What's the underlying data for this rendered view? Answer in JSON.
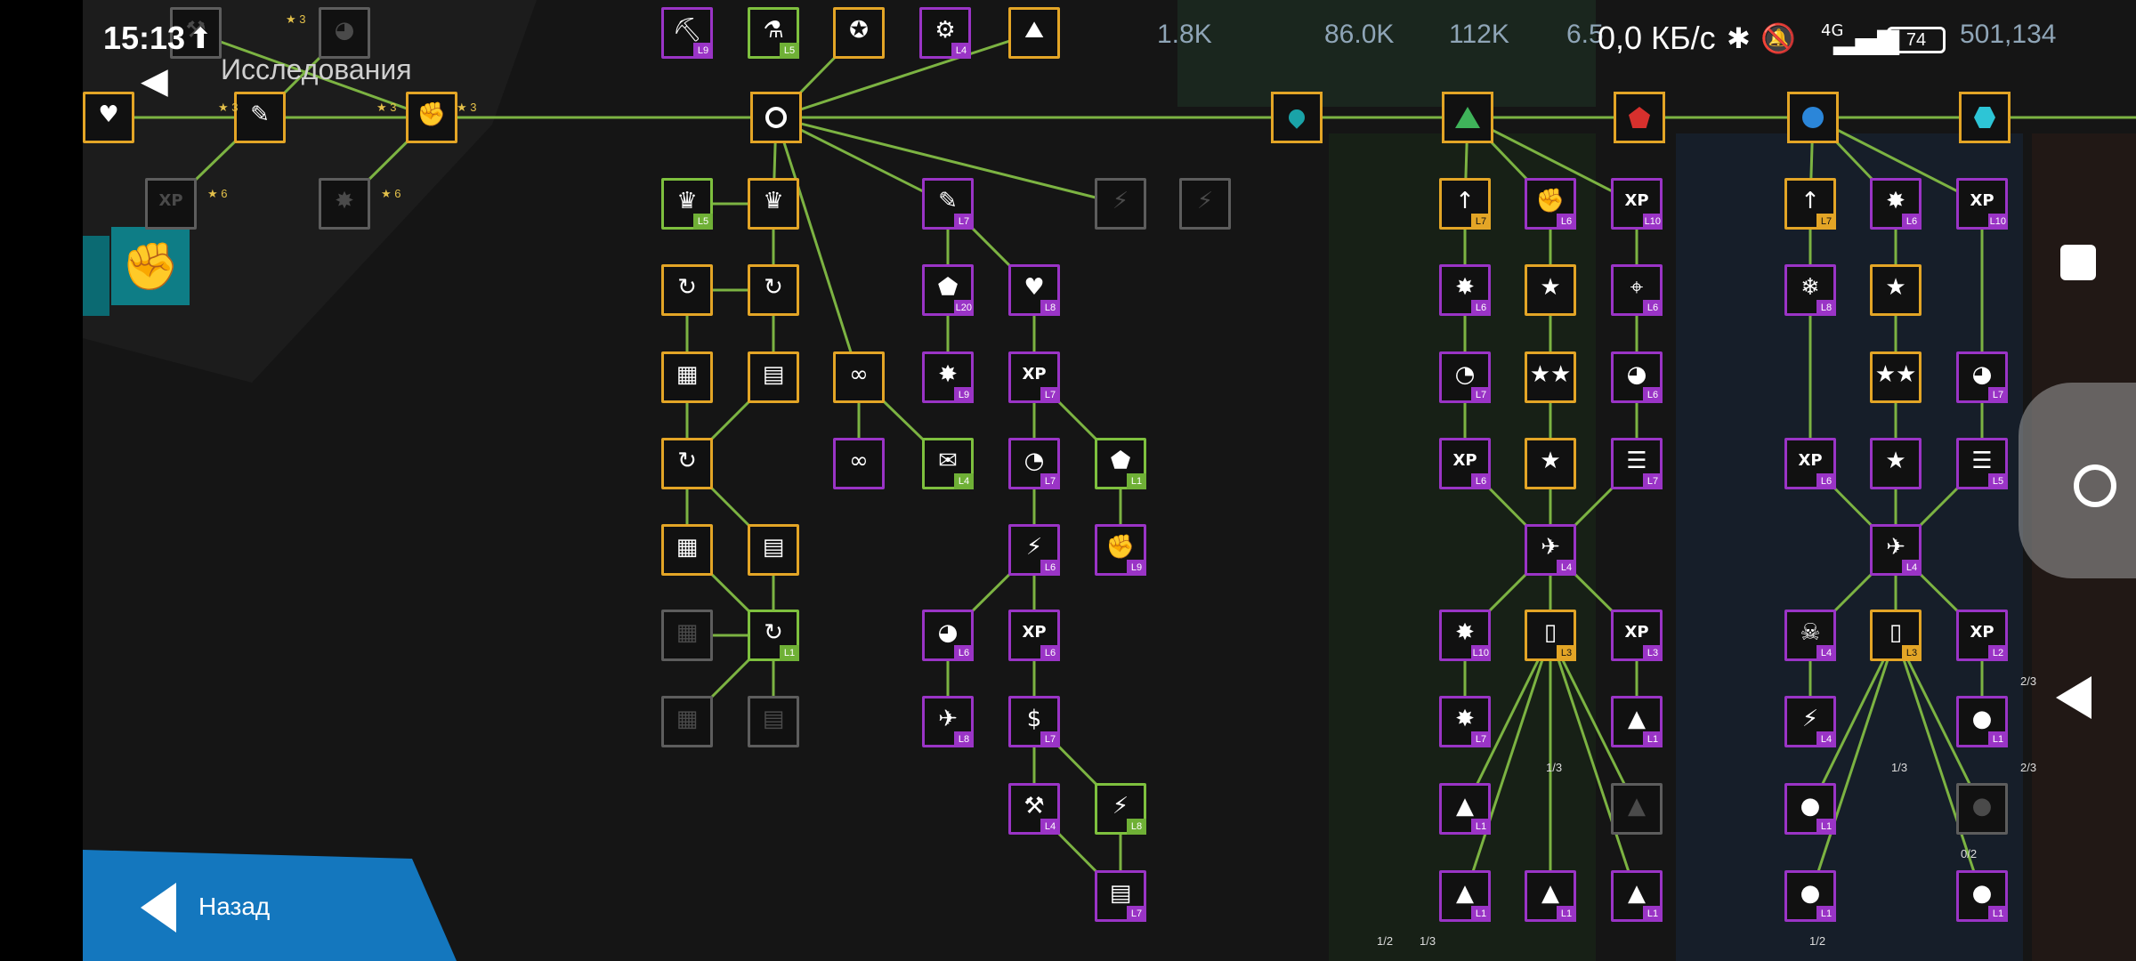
{
  "status_bar": {
    "time": "15:13",
    "network_speed": "0,0 КБ/с",
    "signal": "4G",
    "battery": "74",
    "resources": [
      "1.8K",
      "86.0K",
      "112K",
      "6.5",
      "501,134"
    ]
  },
  "screen": {
    "title": "Исследования",
    "back_label": "Назад"
  },
  "colors": {
    "gold": "#e3a526",
    "purple": "#9a34c6",
    "green": "#7ec03e",
    "line": "#7cb342",
    "accent_blue": "#1477be"
  },
  "tree_labels": {
    "stars": [
      "3",
      "3",
      "3",
      "3",
      "6",
      "6"
    ],
    "fractions": [
      "1/3",
      "1/3",
      "0/2",
      "2/3",
      "2/3",
      "1/2",
      "1/3",
      "1/2"
    ]
  },
  "nodes": [
    {
      "id": "a1",
      "glyph": "⛏",
      "tier": "purple",
      "level": "L9"
    },
    {
      "id": "a2",
      "glyph": "⚗",
      "tier": "green",
      "level": "L5"
    },
    {
      "id": "a3",
      "glyph": "✪",
      "tier": "gold",
      "level": ""
    },
    {
      "id": "a4",
      "glyph": "⚙",
      "tier": "purple",
      "level": "L4"
    },
    {
      "id": "a5",
      "glyph": "⛰",
      "tier": "gold",
      "level": ""
    },
    {
      "id": "t1",
      "glyph": "♛",
      "tier": "green",
      "level": "L5"
    },
    {
      "id": "t2",
      "glyph": "♛",
      "tier": "gold",
      "level": ""
    },
    {
      "id": "t3",
      "glyph": "✎",
      "tier": "purple",
      "level": "L7"
    },
    {
      "id": "t4",
      "glyph": "⚡",
      "tier": "gray",
      "level": ""
    },
    {
      "id": "t5",
      "glyph": "⚡",
      "tier": "gray",
      "level": ""
    },
    {
      "id": "u1",
      "glyph": "↻",
      "tier": "gold",
      "level": ""
    },
    {
      "id": "u2",
      "glyph": "↻",
      "tier": "gold",
      "level": ""
    },
    {
      "id": "u3",
      "glyph": "⬟",
      "tier": "purple",
      "level": "L20"
    },
    {
      "id": "u4",
      "glyph": "♥",
      "tier": "purple",
      "level": "L8"
    },
    {
      "id": "v1",
      "glyph": "▦",
      "tier": "gold",
      "level": ""
    },
    {
      "id": "v2",
      "glyph": "▤",
      "tier": "gold",
      "level": ""
    },
    {
      "id": "v3",
      "glyph": "∞",
      "tier": "gold",
      "level": ""
    },
    {
      "id": "v4",
      "glyph": "✸",
      "tier": "purple",
      "level": "L9"
    },
    {
      "id": "v5",
      "glyph": "XP",
      "tier": "purple",
      "level": "L7"
    },
    {
      "id": "w1",
      "glyph": "↻",
      "tier": "gold",
      "level": ""
    },
    {
      "id": "w2",
      "glyph": "∞",
      "tier": "purple",
      "level": ""
    },
    {
      "id": "w3",
      "glyph": "✉",
      "tier": "green",
      "level": "L4"
    },
    {
      "id": "w4",
      "glyph": "◔",
      "tier": "purple",
      "level": "L7"
    },
    {
      "id": "w5",
      "glyph": "⬟",
      "tier": "green",
      "level": "L1"
    },
    {
      "id": "x1",
      "glyph": "▦",
      "tier": "gold",
      "level": ""
    },
    {
      "id": "x2",
      "glyph": "▤",
      "tier": "gold",
      "level": ""
    },
    {
      "id": "x3",
      "glyph": "⚡",
      "tier": "purple",
      "level": "L6"
    },
    {
      "id": "x4",
      "glyph": "✊",
      "tier": "purple",
      "level": "L9"
    },
    {
      "id": "y1",
      "glyph": "▦",
      "tier": "gray",
      "level": ""
    },
    {
      "id": "y2",
      "glyph": "↻",
      "tier": "green",
      "level": "L1"
    },
    {
      "id": "y3",
      "glyph": "◕",
      "tier": "purple",
      "level": "L6"
    },
    {
      "id": "y4",
      "glyph": "XP",
      "tier": "purple",
      "level": "L6"
    },
    {
      "id": "z1",
      "glyph": "▦",
      "tier": "gray",
      "level": ""
    },
    {
      "id": "z2",
      "glyph": "▤",
      "tier": "gray",
      "level": ""
    },
    {
      "id": "z3",
      "glyph": "✈",
      "tier": "purple",
      "level": "L8"
    },
    {
      "id": "z4",
      "glyph": "$",
      "tier": "purple",
      "level": "L7"
    },
    {
      "id": "zz1",
      "glyph": "⚒",
      "tier": "purple",
      "level": "L4"
    },
    {
      "id": "zz2",
      "glyph": "⚡",
      "tier": "green",
      "level": "L8"
    },
    {
      "id": "zz3",
      "glyph": "▤",
      "tier": "purple",
      "level": "L7"
    },
    {
      "id": "g1",
      "glyph": "↑",
      "tier": "gold",
      "level": "L7"
    },
    {
      "id": "g2",
      "glyph": "✊",
      "tier": "purple",
      "level": "L6"
    },
    {
      "id": "g3",
      "glyph": "XP",
      "tier": "purple",
      "level": "L10"
    },
    {
      "id": "g4",
      "glyph": "✸",
      "tier": "purple",
      "level": "L6"
    },
    {
      "id": "g5",
      "glyph": "★",
      "tier": "gold",
      "level": ""
    },
    {
      "id": "g6",
      "glyph": "⌖",
      "tier": "purple",
      "level": "L6"
    },
    {
      "id": "g7",
      "glyph": "◔",
      "tier": "purple",
      "level": "L7"
    },
    {
      "id": "g8",
      "glyph": "★★",
      "tier": "gold",
      "level": ""
    },
    {
      "id": "g9",
      "glyph": "◕",
      "tier": "purple",
      "level": "L6"
    },
    {
      "id": "g10",
      "glyph": "XP",
      "tier": "purple",
      "level": "L6"
    },
    {
      "id": "g11",
      "glyph": "★",
      "tier": "gold",
      "level": ""
    },
    {
      "id": "g12",
      "glyph": "☰",
      "tier": "purple",
      "level": "L7"
    },
    {
      "id": "g13",
      "glyph": "✈",
      "tier": "purple",
      "level": "L4"
    },
    {
      "id": "g14",
      "glyph": "✸",
      "tier": "purple",
      "level": "L10"
    },
    {
      "id": "g15",
      "glyph": "▯",
      "tier": "gold",
      "level": "L3"
    },
    {
      "id": "g16",
      "glyph": "XP",
      "tier": "purple",
      "level": "L3"
    },
    {
      "id": "g17",
      "glyph": "✸",
      "tier": "purple",
      "level": "L7"
    },
    {
      "id": "g18",
      "glyph": "▲",
      "tier": "purple",
      "level": "L1"
    },
    {
      "id": "g19",
      "glyph": "▲",
      "tier": "purple",
      "level": "L1"
    },
    {
      "id": "g20",
      "glyph": "▲",
      "tier": "gray",
      "level": ""
    },
    {
      "id": "g21",
      "glyph": "▲",
      "tier": "purple",
      "level": "L1"
    },
    {
      "id": "g22",
      "glyph": "▲",
      "tier": "purple",
      "level": "L1"
    },
    {
      "id": "g23",
      "glyph": "▲",
      "tier": "purple",
      "level": "L1"
    },
    {
      "id": "b1",
      "glyph": "↑",
      "tier": "gold",
      "level": "L7"
    },
    {
      "id": "b2",
      "glyph": "✸",
      "tier": "purple",
      "level": "L6"
    },
    {
      "id": "b3",
      "glyph": "XP",
      "tier": "purple",
      "level": "L10"
    },
    {
      "id": "b4",
      "glyph": "❄",
      "tier": "purple",
      "level": "L8"
    },
    {
      "id": "b5",
      "glyph": "★",
      "tier": "gold",
      "level": ""
    },
    {
      "id": "b7",
      "glyph": "★★",
      "tier": "gold",
      "level": ""
    },
    {
      "id": "b8",
      "glyph": "◕",
      "tier": "purple",
      "level": "L7"
    },
    {
      "id": "b9",
      "glyph": "XP",
      "tier": "purple",
      "level": "L6"
    },
    {
      "id": "b10",
      "glyph": "★",
      "tier": "purple",
      "level": ""
    },
    {
      "id": "b11",
      "glyph": "☰",
      "tier": "purple",
      "level": "L5"
    },
    {
      "id": "b12",
      "glyph": "✈",
      "tier": "purple",
      "level": "L4"
    },
    {
      "id": "b13",
      "glyph": "☠",
      "tier": "purple",
      "level": "L4"
    },
    {
      "id": "b14",
      "glyph": "▯",
      "tier": "gold",
      "level": "L3"
    },
    {
      "id": "b15",
      "glyph": "XP",
      "tier": "purple",
      "level": "L2"
    },
    {
      "id": "b16",
      "glyph": "⚡",
      "tier": "purple",
      "level": "L4"
    },
    {
      "id": "b17",
      "glyph": "●",
      "tier": "purple",
      "level": "L1"
    },
    {
      "id": "b18",
      "glyph": "●",
      "tier": "purple",
      "level": "L1"
    },
    {
      "id": "b19",
      "glyph": "●",
      "tier": "gray",
      "level": ""
    },
    {
      "id": "b20",
      "glyph": "●",
      "tier": "purple",
      "level": "L1"
    },
    {
      "id": "b21",
      "glyph": "●",
      "tier": "purple",
      "level": "L1"
    },
    {
      "id": "l1",
      "glyph": "✊",
      "tier": "gold",
      "level": ""
    },
    {
      "id": "l2",
      "glyph": "✎",
      "tier": "gold",
      "level": ""
    },
    {
      "id": "l3",
      "glyph": "♥",
      "tier": "gold",
      "level": ""
    },
    {
      "id": "l4",
      "glyph": "XP",
      "tier": "gray",
      "level": ""
    },
    {
      "id": "l5",
      "glyph": "✸",
      "tier": "gray",
      "level": ""
    },
    {
      "id": "l6",
      "glyph": "◕",
      "tier": "gray",
      "level": ""
    },
    {
      "id": "l7",
      "glyph": "⚒",
      "tier": "gray",
      "level": ""
    }
  ]
}
